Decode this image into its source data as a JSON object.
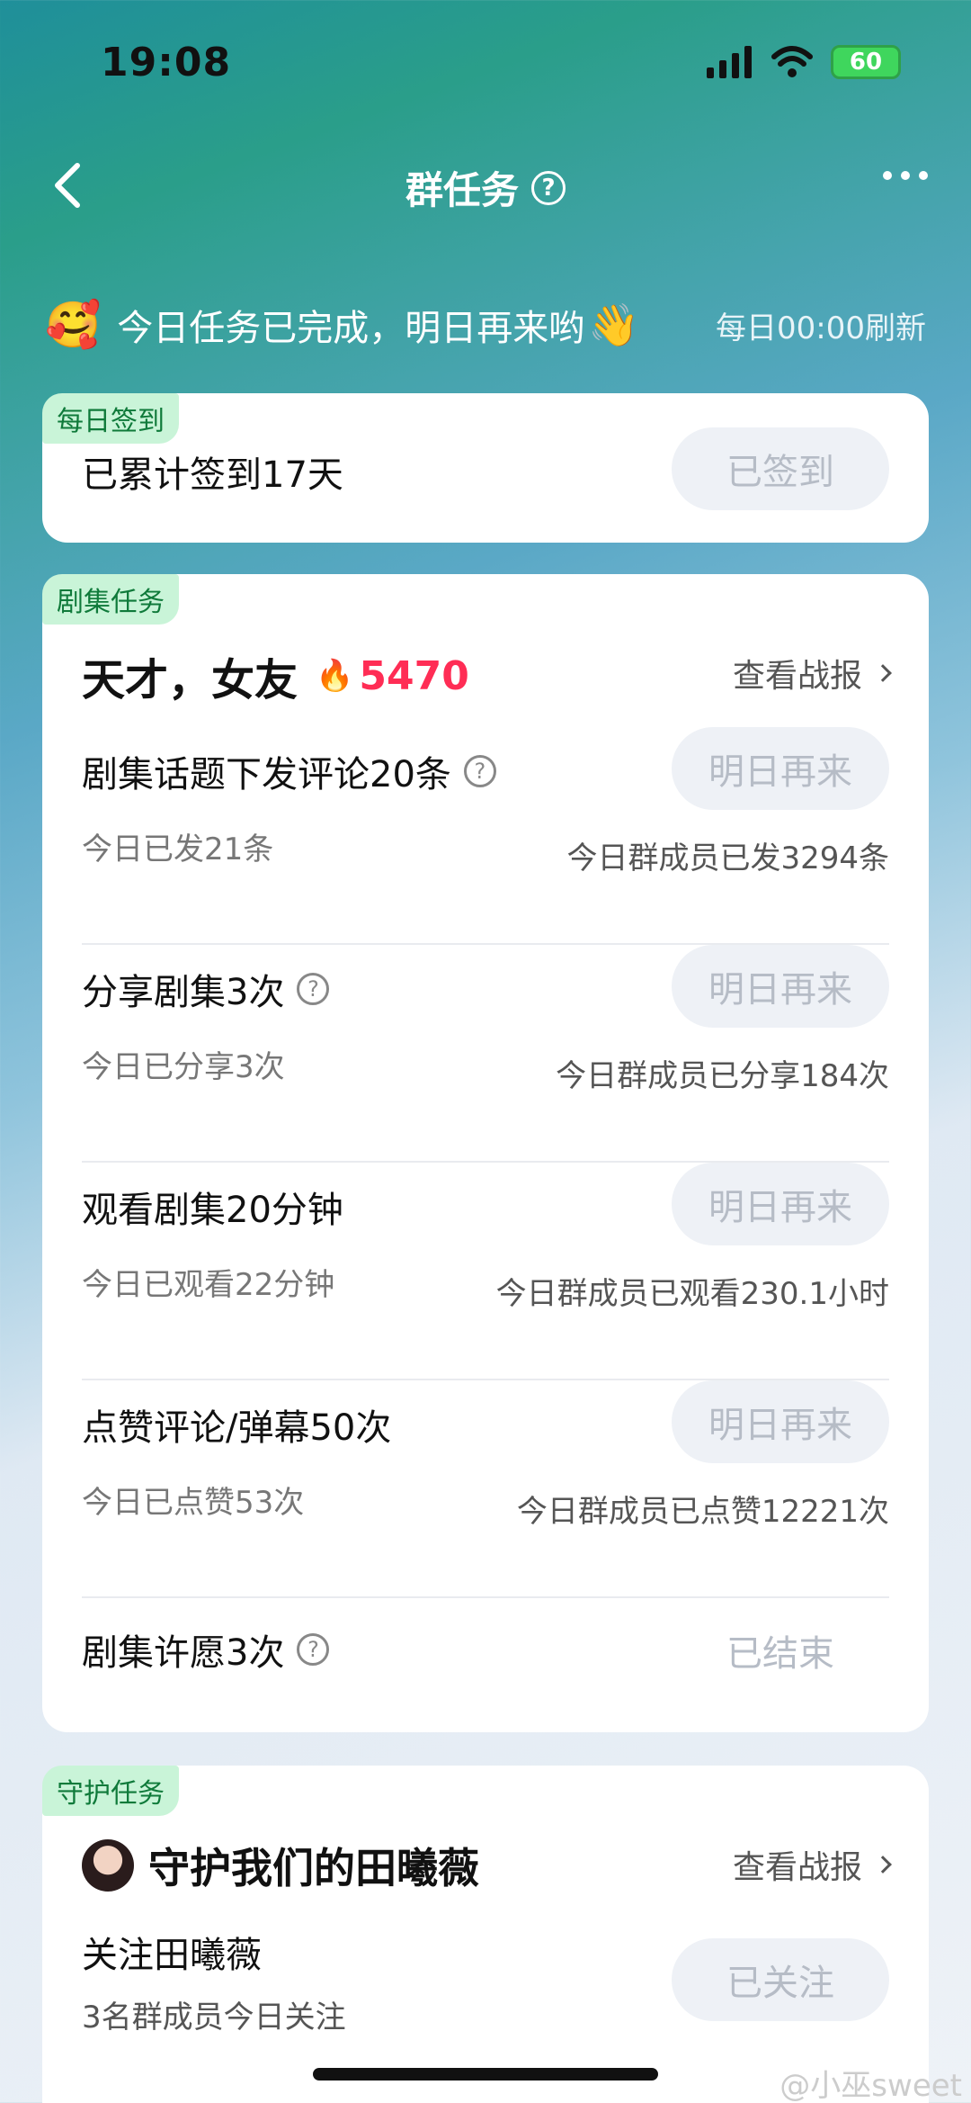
{
  "status": {
    "time": "19:08",
    "battery": "60"
  },
  "nav": {
    "title": "群任务",
    "help": "?"
  },
  "banner": {
    "emoji": "🥰",
    "message": "今日任务已完成，明日再来哟",
    "wave": "👋",
    "refresh": "每日00:00刷新"
  },
  "signin": {
    "tag": "每日签到",
    "text": "已累计签到17天",
    "button": "已签到"
  },
  "drama": {
    "tag": "剧集任务",
    "title": "天才，女友",
    "fire": "🔥",
    "score": "5470",
    "report": "查看战报",
    "tasks": [
      {
        "title": "剧集话题下发评论20条",
        "left": "今日已发21条",
        "right": "今日群成员已发3294条",
        "button": "明日再来"
      },
      {
        "title": "分享剧集3次",
        "left": "今日已分享3次",
        "right": "今日群成员已分享184次",
        "button": "明日再来"
      },
      {
        "title": "观看剧集20分钟",
        "left": "今日已观看22分钟",
        "right": "今日群成员已观看230.1小时",
        "button": "明日再来"
      },
      {
        "title": "点赞评论/弹幕50次",
        "left": "今日已点赞53次",
        "right": "今日群成员已点赞12221次",
        "button": "明日再来"
      },
      {
        "title": "剧集许愿3次",
        "button": "已结束"
      }
    ]
  },
  "guard": {
    "tag": "守护任务",
    "title": "守护我们的田曦薇",
    "report": "查看战报",
    "sub_title": "关注田曦薇",
    "sub_desc": "3名群成员今日关注",
    "button": "已关注"
  },
  "watermark": "@小巫sweet"
}
